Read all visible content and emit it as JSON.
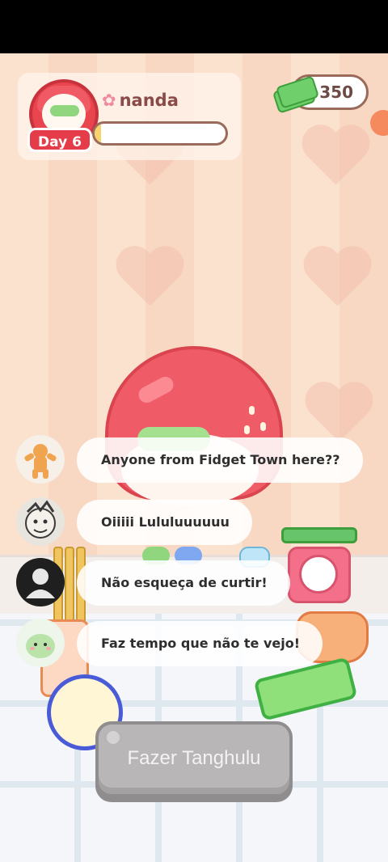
{
  "player": {
    "name": "nanda",
    "name_prefix_icon": "flower-icon",
    "day_label": "Day 6",
    "xp_progress": 0.05
  },
  "currency": {
    "icon": "cash-icon",
    "value": "350"
  },
  "chat": {
    "messages": [
      {
        "avatar": "gingerbread-avatar",
        "text": "Anyone from Fidget Town here??"
      },
      {
        "avatar": "sketch-avatar",
        "text": "Oiiiii Lululuuuuuu"
      },
      {
        "avatar": "default-avatar",
        "text": "Não esqueça de curtir!"
      },
      {
        "avatar": "green-blob-avatar",
        "text": "Faz tempo que não te vejo!"
      }
    ]
  },
  "actions": {
    "make_label": "Fazer Tanghulu",
    "make_enabled": false
  },
  "colors": {
    "accent_red": "#e43c48",
    "button_disabled": "#b8b6b6",
    "money_text": "#6e4a44"
  }
}
